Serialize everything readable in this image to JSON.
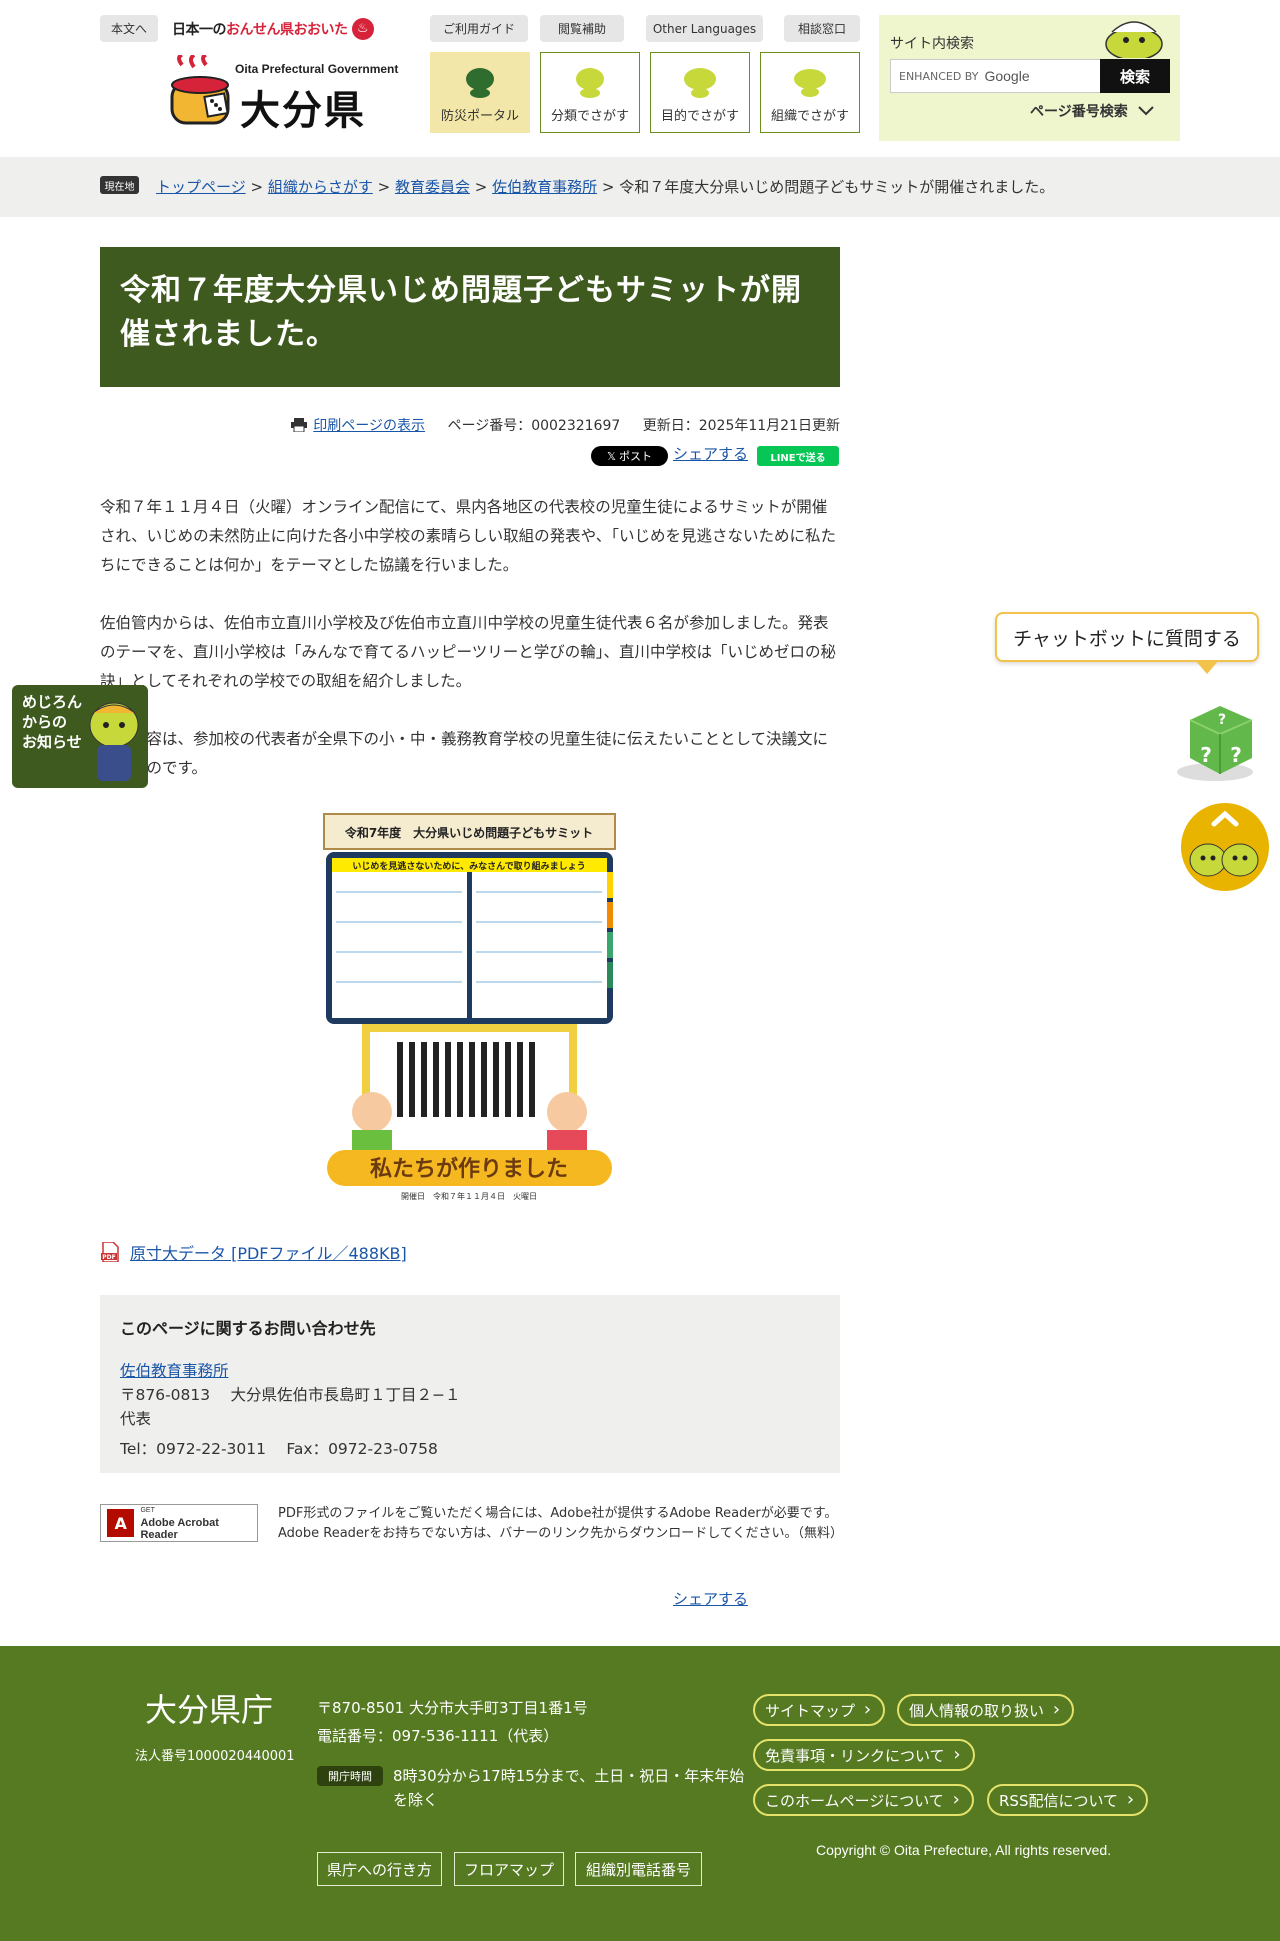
{
  "header": {
    "skip_link": "本文へ",
    "onsen_prefix": "日本一の",
    "onsen_brand": "おんせん県おおいた",
    "logo_en": "Oita Prefectural Government",
    "logo_ja": "大分県",
    "top_links": [
      "ご利用ガイド",
      "閲覧補助",
      "Other Languages",
      "相談窓口"
    ],
    "nav_cards": [
      "防災ポータル",
      "分類でさがす",
      "目的でさがす",
      "組織でさがす"
    ],
    "search": {
      "label": "サイト内検索",
      "placeholder_prefix": "ENHANCED BY",
      "placeholder_brand": "Google",
      "button": "検索",
      "page_number_search": "ページ番号検索"
    }
  },
  "breadcrumb": {
    "tag": "現在地",
    "items": [
      "トップページ",
      "組織からさがす",
      "教育委員会",
      "佐伯教育事務所"
    ],
    "current": "令和７年度大分県いじめ問題子どもサミットが開催されました。"
  },
  "article": {
    "title": "令和７年度大分県いじめ問題子どもサミットが開催されました。",
    "print_link": "印刷ページの表示",
    "page_number": "ページ番号：0002321697",
    "updated": "更新日：2025年11月21日更新",
    "x_post": "𝕏 ポスト",
    "share": "シェアする",
    "line_share": "LINEで送る",
    "paragraphs": [
      "令和７年１１月４日（火曜）オンライン配信にて、県内各地区の代表校の児童生徒によるサミットが開催され、いじめの未然防止に向けた各小中学校の素晴らしい取組の発表や、「いじめを見逃さないために私たちにできることは何か」をテーマとした協議を行いました。",
      "佐伯管内からは、佐伯市立直川小学校及び佐伯市立直川中学校の児童生徒代表６名が参加しました。発表のテーマを、直川小学校は「みんなで育てるハッピーツリーと学びの輪」、直川中学校は「いじめゼロの秘訣」としてそれぞれの学校での取組を紹介しました。",
      "協議内容は、参加校の代表者が全県下の小・中・義務教育学校の児童生徒に伝えたいこととして決議文にしたものです。"
    ],
    "poster": {
      "title": "令和7年度　大分県いじめ問題子どもサミット",
      "subtitle": "いじめを見逃さないために、みなさんで取り組みましょう",
      "slogan": "私たちが作りました",
      "date": "開催日　令和７年１１月４日　火曜日"
    },
    "pdf_link": "原寸大データ [PDFファイル／488KB]"
  },
  "contact": {
    "title": "このページに関するお問い合わせ先",
    "office": "佐伯教育事務所",
    "address": "〒876-0813　 大分県佐伯市長島町１丁目２−１",
    "rep": "代表",
    "tel_fax": "Tel：0972-22-3011　 Fax：0972-23-0758"
  },
  "acrobat": {
    "get": "GET",
    "name": "Adobe Acrobat Reader",
    "note": "PDF形式のファイルをご覧いただく場合には、Adobe社が提供するAdobe Readerが必要です。Adobe Readerをお持ちでない方は、バナーのリンク先からダウンロードしてください。（無料）"
  },
  "floating": {
    "mejiron": "めじろん\nからの\nお知らせ",
    "chatbot": "チャットボットに質問する"
  },
  "footer": {
    "name": "大分県庁",
    "corp_number": "法人番号1000020440001",
    "address": "〒870-8501 大分市大手町3丁目1番1号",
    "phone": "電話番号：097-536-1111（代表）",
    "hours_tag": "開庁時間",
    "hours": "8時30分から17時15分まで、土日・祝日・年末年始を除く",
    "square_links": [
      "県庁への行き方",
      "フロアマップ",
      "組織別電話番号"
    ],
    "pill_links": [
      "サイトマップ",
      "個人情報の取り扱い",
      "免責事項・リンクについて",
      "このホームページについて",
      "RSS配信について"
    ],
    "copyright": "Copyright © Oita Prefecture, All rights reserved."
  },
  "colors": {
    "brand_green": "#3e5a1f",
    "footer_green": "#557a22",
    "search_bg": "#eff5cc",
    "link_blue": "#1a56a8"
  }
}
